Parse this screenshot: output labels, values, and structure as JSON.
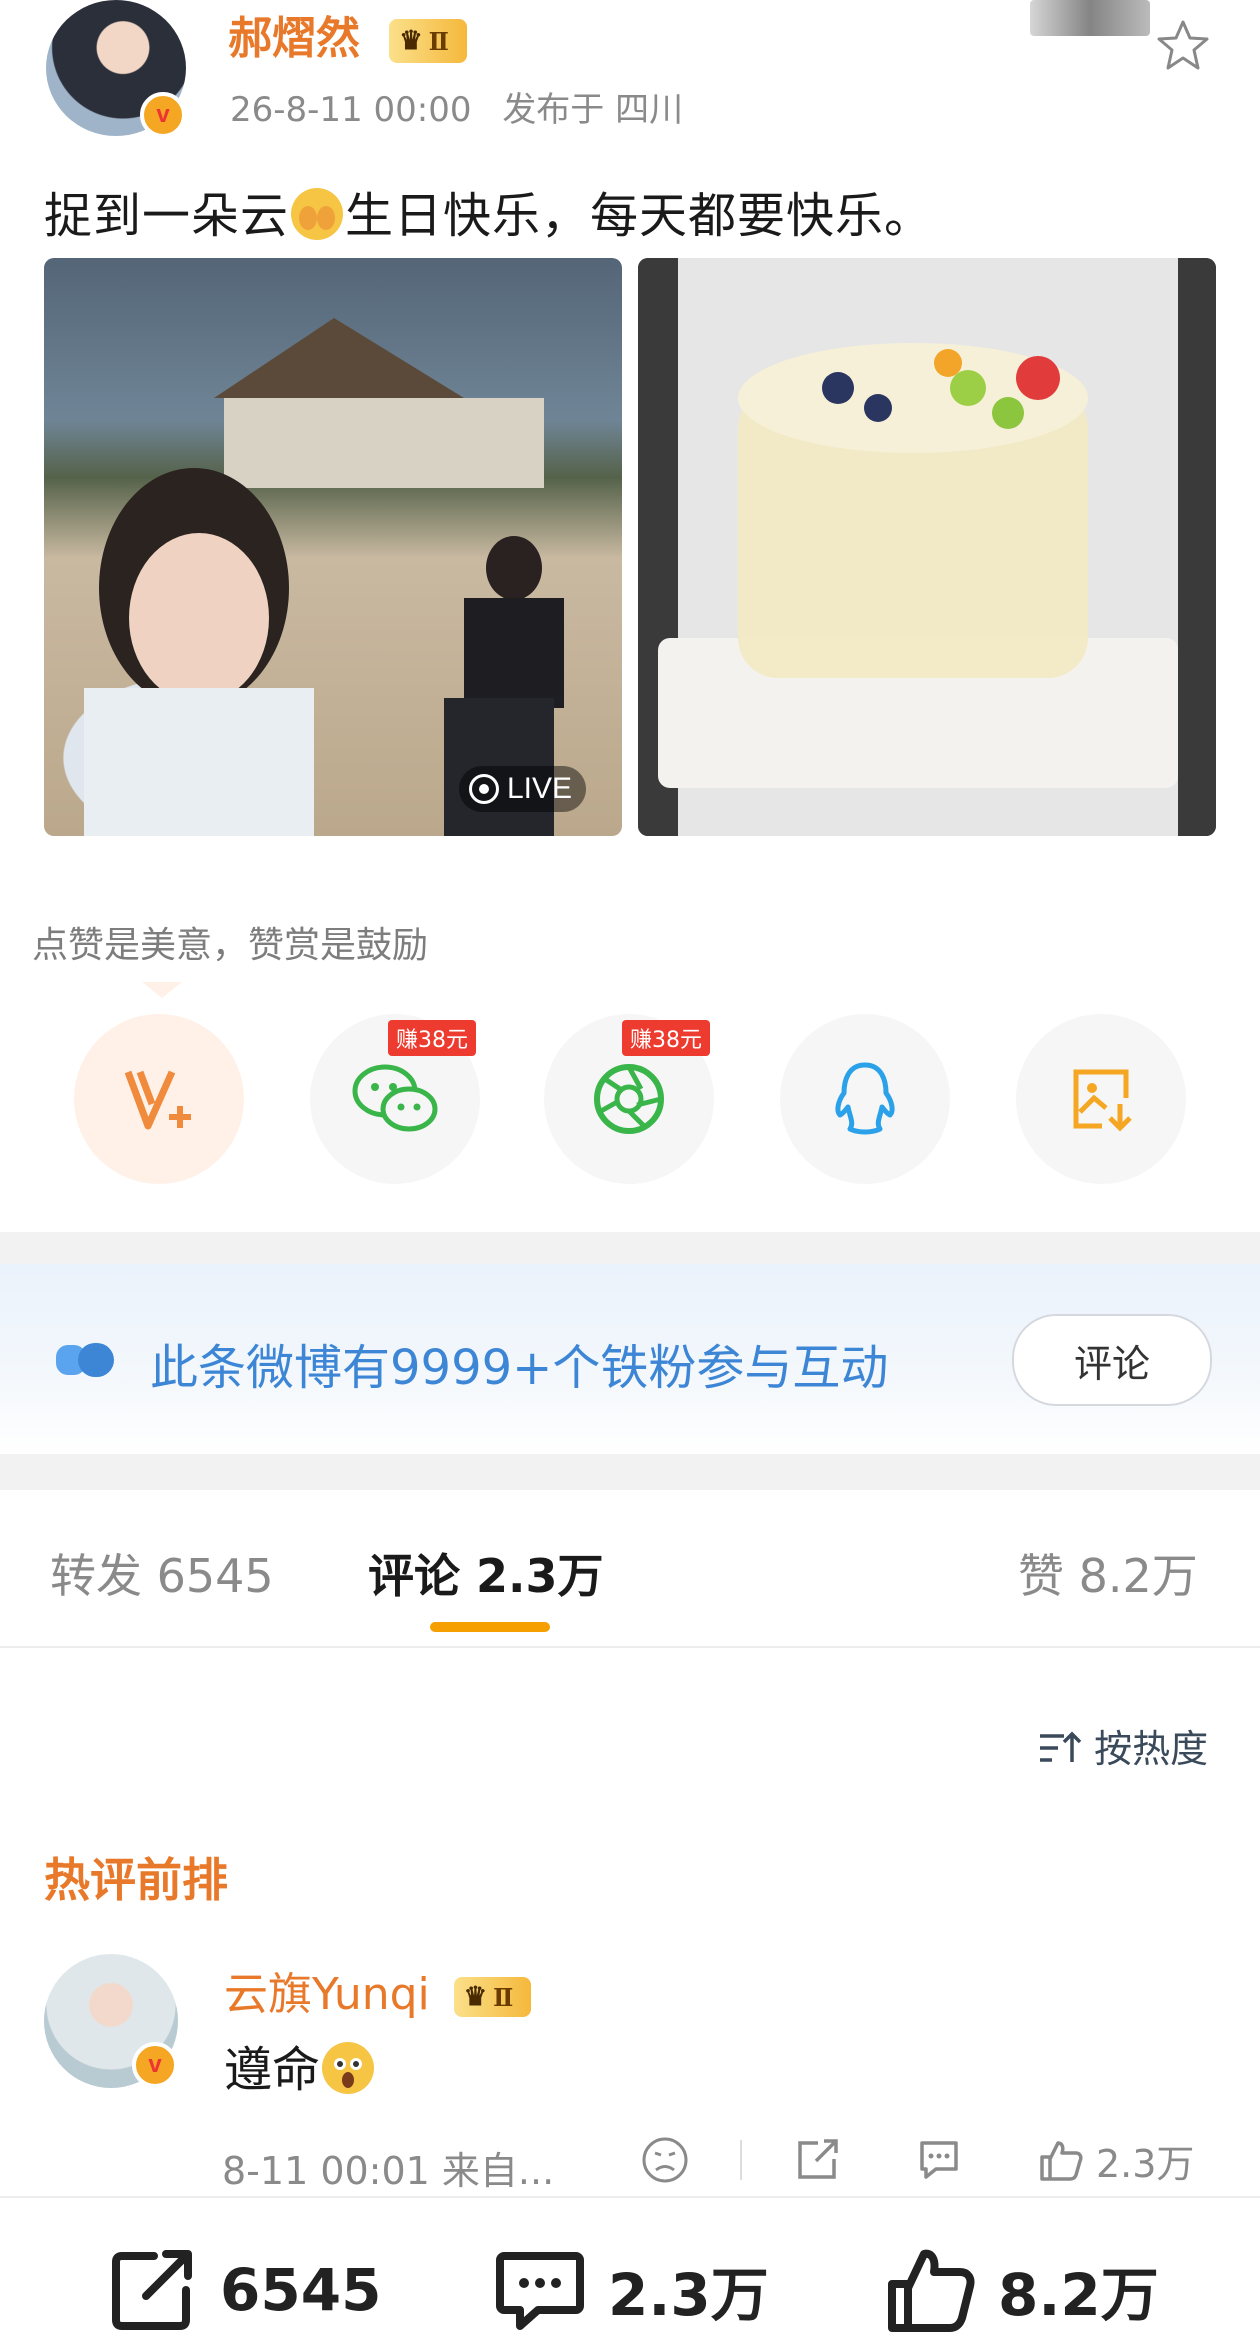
{
  "post": {
    "author": "郝熠然",
    "vip_level": "Ⅱ",
    "verified_mark": "v",
    "date": "26-8-11 00:00",
    "location": "发布于 四川",
    "text_part1": "捉到一朵云",
    "text_part2": "生日快乐，每天都要快乐。",
    "live_label": "LIVE"
  },
  "reward_tip": "点赞是美意，赞赏是鼓励",
  "share_row": [
    {
      "icon": "weibo-v-plus-icon",
      "badge": ""
    },
    {
      "icon": "wechat-icon",
      "badge": "赚38元"
    },
    {
      "icon": "moments-icon",
      "badge": "赚38元"
    },
    {
      "icon": "qq-icon",
      "badge": ""
    },
    {
      "icon": "save-image-icon",
      "badge": ""
    }
  ],
  "fans_banner": {
    "text": "此条微博有9999+个铁粉参与互动",
    "button": "评论"
  },
  "tabs": {
    "repost": "转发 6545",
    "comment": "评论 2.3万",
    "like": "赞 8.2万"
  },
  "sort_label": "按热度",
  "hot_title": "热评前排",
  "comment": {
    "author": "云旗Yunqi",
    "vip_level": "Ⅱ",
    "text": "遵命",
    "meta": "8-11 00:01  来自...",
    "likes": "2.3万"
  },
  "bottom_bar": {
    "repost": "6545",
    "comment": "2.3万",
    "like": "8.2万"
  },
  "colors": {
    "accent_orange": "#e8792a",
    "link_blue": "#3d86d6",
    "tab_underline": "#f5a000",
    "badge_red": "#ee3b2f",
    "wechat_green": "#39b54a",
    "qq_blue": "#2aa1e8"
  }
}
